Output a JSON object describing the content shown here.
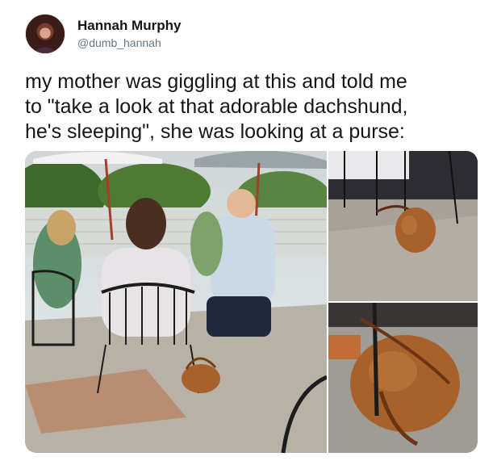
{
  "user": {
    "display_name": "Hannah Murphy",
    "handle": "@dumb_hannah",
    "avatar_icon": "profile-avatar"
  },
  "tweet": {
    "text": "my mother was giggling at this and told me\nto \"take a look at that adorable dachshund,\nhe's sleeping\", she was looking at a purse:"
  },
  "media": {
    "count": 3,
    "photos": [
      "patio-scene-photo",
      "purse-closeup-top-photo",
      "purse-closeup-bottom-photo"
    ]
  },
  "colors": {
    "text_primary": "#14171a",
    "text_secondary": "#657786",
    "purse_brown": "#a9612c"
  }
}
